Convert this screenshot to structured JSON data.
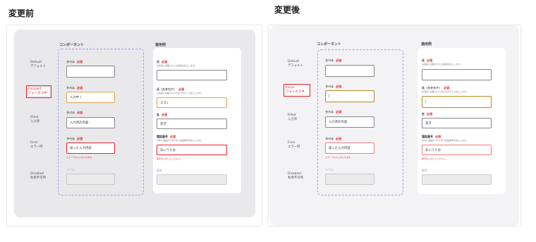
{
  "headings": {
    "before": "変更前",
    "after": "変更後"
  },
  "columns": {
    "component": "コンポーネント",
    "example": "適用例"
  },
  "before_states": [
    {
      "en": "Default",
      "ja": "デフォルト"
    },
    {
      "en": "Focused",
      "ja": "フォーカス中"
    },
    {
      "en": "Filled",
      "ja": "入力済"
    },
    {
      "en": "Error",
      "ja": "エラー時"
    },
    {
      "en": "Disabled",
      "ja": "利用不可時"
    }
  ],
  "after_states": [
    {
      "en": "Default",
      "ja": "デフォルト"
    },
    {
      "en": "Focus",
      "ja": "フォーカス中"
    },
    {
      "en": "Filled",
      "ja": "入力済"
    },
    {
      "en": "Error",
      "ja": "エラー時"
    },
    {
      "en": "Disabled",
      "ja": "利用不可時"
    }
  ],
  "component": {
    "label": "ラベル",
    "required": "必須",
    "focused_value_before": "入力中 |",
    "focused_value_after": "|",
    "filled_value": "入力済の内容",
    "error_value": "誤った入力内容",
    "error_message": "エラーテキストが入ります。"
  },
  "example": {
    "last_name_label": "氏",
    "last_name_desc": "お名前に記載されたお名前を記入します。",
    "kana_label": "氏（カタカナ）",
    "kana_desc": "お名前に記載された氏をカタカナで記入します。",
    "kana_value_before": "スズ |",
    "kana_value_after": "|",
    "first_name_label": "名",
    "first_name_value": "花子",
    "phone_label": "電話番号",
    "phone_desc": "日中に連絡がつきやすい電話番号を記入します。",
    "phone_value": "あいうえお",
    "phone_error": "数字を入力してください。",
    "remarks_label": "備考"
  },
  "colors": {
    "required": "#e8232a",
    "focus_before": "#e8a24a",
    "focus_after": "#b58a1f",
    "dashed": "#a89ce6"
  }
}
